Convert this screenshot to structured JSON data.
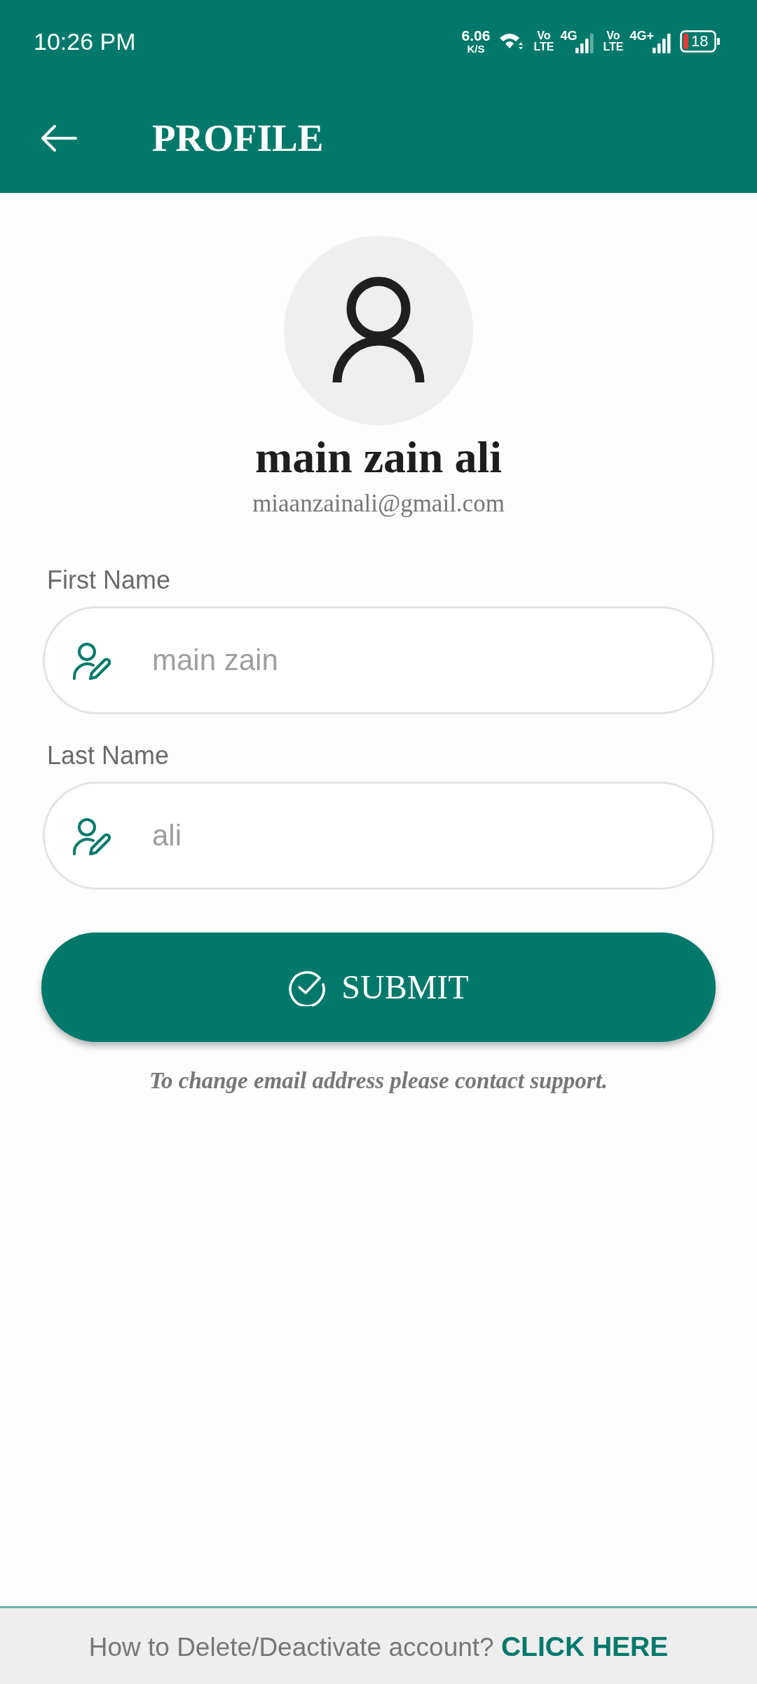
{
  "status_bar": {
    "time": "10:26 PM",
    "net_speed": {
      "value": "6.06",
      "unit": "K/S"
    },
    "sims": [
      {
        "voice": [
          "Vo",
          "LTE"
        ],
        "network": "4G"
      },
      {
        "voice": [
          "Vo",
          "LTE"
        ],
        "network": "4G+"
      }
    ],
    "battery": "18"
  },
  "app_bar": {
    "title": "PROFILE"
  },
  "profile": {
    "name": "main zain ali",
    "email": "miaanzainali@gmail.com"
  },
  "fields": [
    {
      "label": "First Name",
      "value": "main zain"
    },
    {
      "label": "Last Name",
      "value": "ali"
    }
  ],
  "submit_button": {
    "label": "SUBMIT"
  },
  "note": "To change email address please contact support.",
  "footer": {
    "text": "How to Delete/Deactivate account?",
    "link": "CLICK HERE"
  }
}
